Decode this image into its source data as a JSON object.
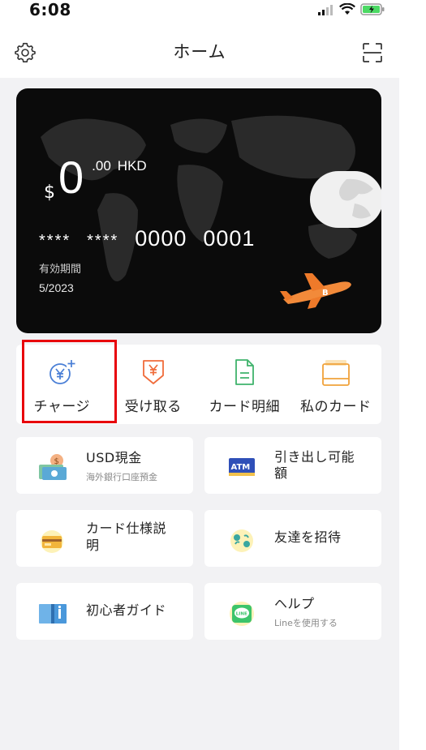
{
  "status_bar": {
    "time": "6:08"
  },
  "nav": {
    "title": "ホーム"
  },
  "card": {
    "currency_symbol": "$",
    "balance_integer": "0",
    "balance_decimal": ".00",
    "currency_code": "HKD",
    "number_masked_1": "****",
    "number_masked_2": "****",
    "number_group_3": "0000",
    "number_group_4": "0001",
    "expiry_label": "有効期間",
    "expiry_value": "5/2023"
  },
  "actions": [
    {
      "label": "チャージ",
      "icon": "yen-plus-icon",
      "color": "#4a7fd6"
    },
    {
      "label": "受け取る",
      "icon": "yen-receive-icon",
      "color": "#f06c3b"
    },
    {
      "label": "カード明細",
      "icon": "statement-icon",
      "color": "#3fb36c"
    },
    {
      "label": "私のカード",
      "icon": "card-wallet-icon",
      "color": "#f0a23a"
    }
  ],
  "tiles": [
    {
      "title": "USD現金",
      "subtitle": "海外銀行口座預金",
      "icon": "usd-cash-icon"
    },
    {
      "title_line1": "引き出し可能",
      "title_line2": "額",
      "icon": "atm-icon",
      "icon_text": "ATM"
    },
    {
      "title_line1": "カード仕様説",
      "title_line2": "明",
      "icon": "card-spec-icon"
    },
    {
      "title": "友達を招待",
      "icon": "invite-friend-icon"
    },
    {
      "title": "初心者ガイド",
      "icon": "guide-book-icon"
    },
    {
      "title": "ヘルプ",
      "subtitle": "Lineを使用する",
      "icon": "line-icon",
      "icon_text": "LINE"
    }
  ]
}
